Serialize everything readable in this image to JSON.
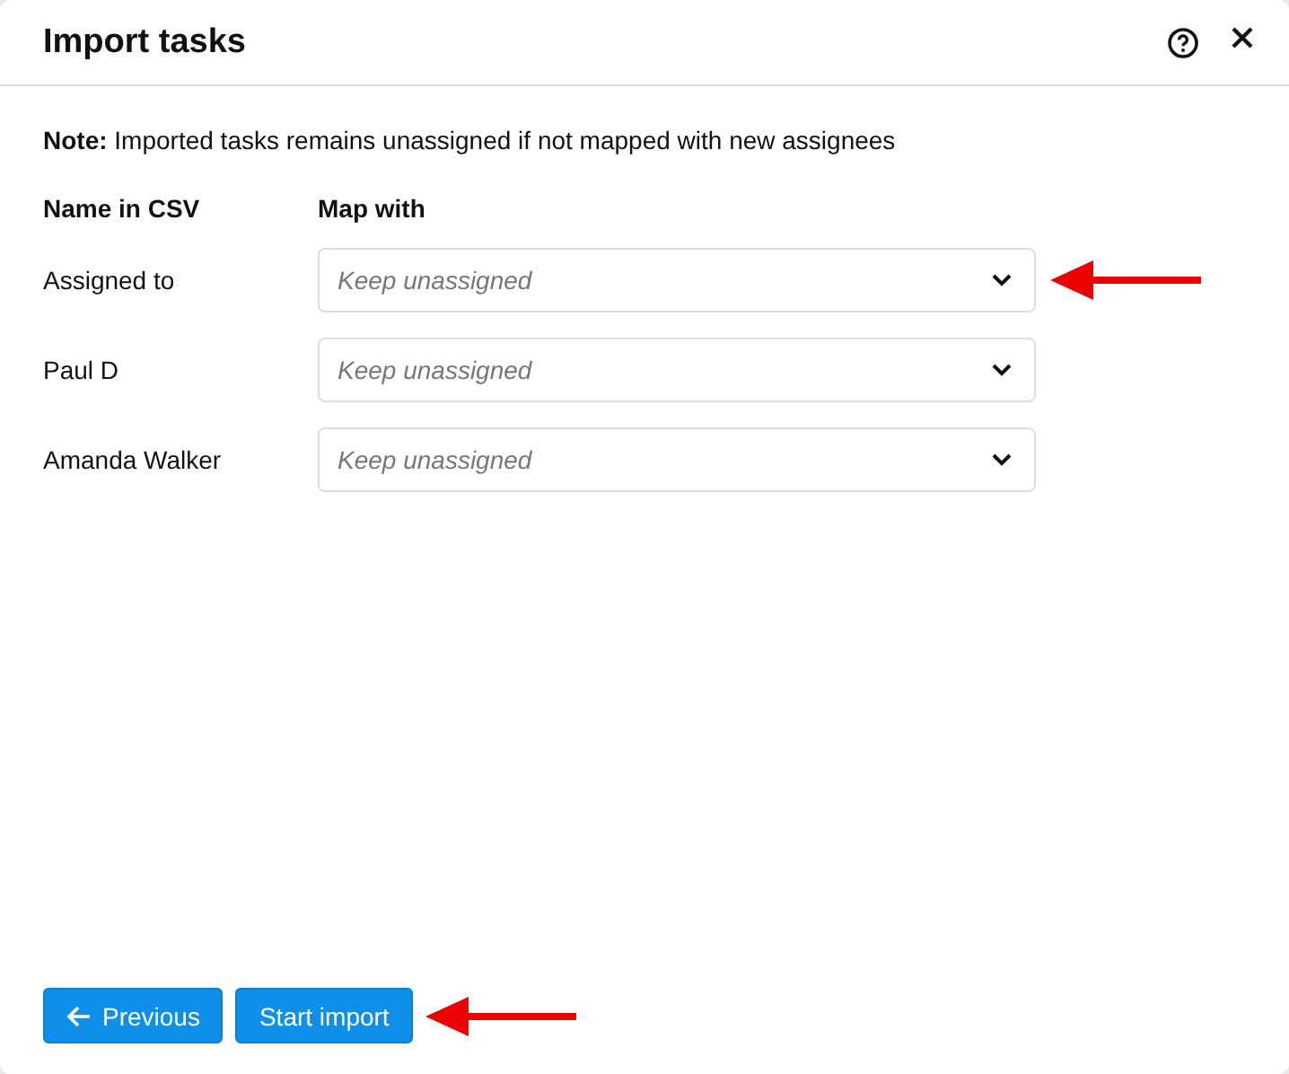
{
  "dialog": {
    "title": "Import tasks"
  },
  "note": "**Note:** Imported tasks remains unassigned if not mapped with new assignees",
  "table": {
    "columns": [
      "Name in CSV",
      "Map with"
    ],
    "rows": [
      {
        "name": "Assigned to",
        "placeholder": "Keep unassigned",
        "callout": true
      },
      {
        "name": "Paul D",
        "placeholder": "Keep unassigned",
        "callout": false
      },
      {
        "name": "Amanda Walker",
        "placeholder": "Keep unassigned",
        "callout": false
      }
    ]
  },
  "buttons": [
    {
      "label": "Previous",
      "kind": "back",
      "callout": false
    },
    {
      "label": "Start import",
      "kind": "primary",
      "callout": true
    }
  ]
}
